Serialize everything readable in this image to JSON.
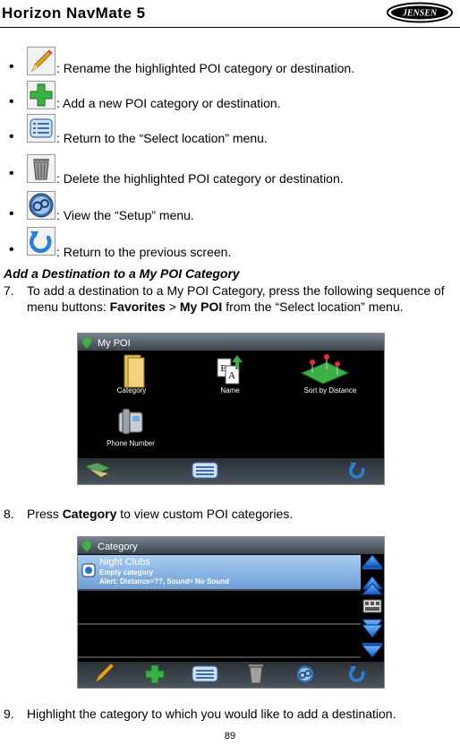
{
  "header": {
    "title": "Horizon NavMate 5",
    "logo_text": "JENSEN"
  },
  "bullets": [
    {
      "icon": "pencil-icon",
      "text": ": Rename the highlighted POI category or destination."
    },
    {
      "icon": "plus-icon",
      "text": ": Add a new POI category or destination."
    },
    {
      "icon": "menu-list-icon",
      "text": ": Return to the “Select location” menu."
    },
    {
      "icon": "trash-icon",
      "text": ": Delete the highlighted POI category or destination."
    },
    {
      "icon": "setup-icon",
      "text": ": View the “Setup” menu."
    },
    {
      "icon": "back-arrow-icon",
      "text": ": Return to the previous screen."
    }
  ],
  "section_title": "Add a Destination to a My POI Category",
  "step7": {
    "num": "7.",
    "text_a": "To add a destination to a My POI Category, press the following sequence of menu buttons: ",
    "b1": "Favorites",
    "sep": " > ",
    "b2": "My POI",
    "text_b": " from the “Select location” menu."
  },
  "screen1": {
    "title": "My POI",
    "items": [
      "Category",
      "Name",
      "Sort by Distance",
      "Phone Number"
    ]
  },
  "step8": {
    "num": "8.",
    "text_a": "Press ",
    "b1": "Category",
    "text_b": " to view custom POI categories."
  },
  "screen2": {
    "title": "Category",
    "row_name": "Night Clubs",
    "row_line2": "Empty category",
    "row_line3": "Alert: Distance=??,  Sound= No Sound"
  },
  "step9": {
    "num": "9.",
    "text": "Highlight the category to which you would like to add a destination."
  },
  "page_number": "89",
  "colors": {
    "screen_bg": "#000000",
    "title_bar": "#4e5a66",
    "selected_row": "#8fb8e6",
    "accent_blue": "#1f6fd6"
  }
}
